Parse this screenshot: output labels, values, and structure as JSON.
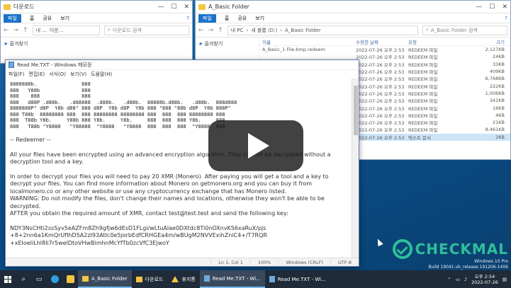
{
  "explorer_left": {
    "title": "다운로드",
    "menu": [
      "파일",
      "홈",
      "공유",
      "보기"
    ],
    "address": "내 ...",
    "address_item": "다운...",
    "search_placeholder": "다운로드 검색",
    "nav_quick": "즐겨찾기"
  },
  "explorer_right": {
    "title": "A_Basic Folder",
    "menu": [
      "파일",
      "홈",
      "공유",
      "보기"
    ],
    "path": [
      "내 PC",
      "새 볼륨 (D:)",
      "A_Basic Folder"
    ],
    "search_placeholder": "A_Basic Folder 검색",
    "nav_quick": "즐겨찾기",
    "columns": [
      "이름",
      "수정한 날짜",
      "유형",
      "크기"
    ],
    "files": [
      {
        "name": "A_Basic_1 File.bmp.redeem",
        "date": "2022-07-26 오후 2:53",
        "type": "REDEEM 파일",
        "size": "2,127KB"
      },
      {
        "name": "",
        "date": "2022-07-26 오후 2:53",
        "type": "REDEEM 파일",
        "size": "24KB"
      },
      {
        "name": "",
        "date": "2022-07-26 오후 2:53",
        "type": "REDEEM 파일",
        "size": "33KB"
      },
      {
        "name": "",
        "date": "2022-07-26 오후 2:53",
        "type": "REDEEM 파일",
        "size": "409KB"
      },
      {
        "name": "",
        "date": "2022-07-26 오후 2:53",
        "type": "REDEEM 파일",
        "size": "6,768KB"
      },
      {
        "name": "",
        "date": "2022-07-26 오후 2:53",
        "type": "REDEEM 파일",
        "size": "222KB"
      },
      {
        "name": "",
        "date": "2022-07-26 오후 2:53",
        "type": "REDEEM 파일",
        "size": "1,006KB"
      },
      {
        "name": "",
        "date": "2022-07-26 오후 2:53",
        "type": "REDEEM 파일",
        "size": "341KB"
      },
      {
        "name": "",
        "date": "2022-07-26 오후 2:53",
        "type": "REDEEM 파일",
        "size": "16KB"
      },
      {
        "name": "",
        "date": "2022-07-26 오후 2:53",
        "type": "REDEEM 파일",
        "size": "4KB"
      },
      {
        "name": "",
        "date": "2022-07-26 오후 2:53",
        "type": "REDEEM 파일",
        "size": "21KB"
      },
      {
        "name": "",
        "date": "2022-07-26 오후 2:53",
        "type": "REDEEM 파일",
        "size": "8,461KB"
      },
      {
        "name": "",
        "date": "2022-07-26 오후 2:53",
        "type": "텍스트 문서",
        "size": "2KB"
      }
    ]
  },
  "notepad": {
    "title": "Read Me.TXT - Windows 메모장",
    "menu": [
      "파일(F)",
      "편집(E)",
      "서식(O)",
      "보기(V)",
      "도움말(H)"
    ],
    "ascii_art": "8888888b.               888\n888   Y88b              888\n888    888              888\n888   d88P .d88b.   .d88888  .d88b.   .d88b.  88888b.d88b.   .d88b.  888d888\n8888888P\" d8P  Y8b d88\" 888 d8P  Y8b d8P  Y8b 888 \"888 \"88b d8P  Y8b 888P\"\n888 T88b  88888888 888  888 88888888 88888888 888  888  888 88888888 888\n888  T88b Y8b.     Y88b 888 Y8b.     Y8b.     888  888  888 Y8b.     888\n888   T88b \"Y8888   \"Y88888  \"Y8888   \"Y8888  888  888  888  \"Y8888  888",
    "heading": "-- Redeemer --",
    "paragraphs": [
      "All your files have been encrypted using an advanced encryption algorithm. They cannot be decrypted without a decryption tool and a key.",
      "In order to decrypt your files you will need to pay 20 XMR (Monero). After paying you will get a tool and a key to decrypt your files. You can find more information about Monero on getmonero.org and you can buy it from localmonero.co or any other website or use any cryptocurrency exchange that has Monero listed.",
      "WARNING: Do not modify the files, don't change their names and locations, otherwise they won't be able to be decrypted.",
      "AFTER you obtain the required amount of XMR, contact test@test.test and send the following key:"
    ],
    "key_lines": [
      "NDY3NsCHti2ssSyv5eAZFm8Zh9gfjw6dEsD1FLgi/wLtuAlae0DXtdc8Ti0nOXnvK56xaRuX/pjs",
      "+8+2nn6a1KmQrUfIhD5A2zI93AtIc0e5jorbEdfCRHGEa4m/wBUgM2NVVExihZniC4+/T7RQR",
      "+xEIoeIiLhl8Ii7r5welDtoVHwBimhnMcYfTb0zcVfC3EjwoY"
    ],
    "status": {
      "position": "Ln 1, Col 1",
      "zoom": "100%",
      "eol": "Windows (CRLF)",
      "encoding": "UTF-8"
    }
  },
  "watermark": {
    "text": "CHECKMAL"
  },
  "os_info": {
    "line1": "Windows 10 Pro",
    "line2": "Build 19041.vb_release.191206-1406"
  },
  "taskbar": {
    "items": [
      {
        "label": "A_Basic Folder",
        "icon": "folder-icon"
      },
      {
        "label": "다운로드",
        "icon": "folder-icon"
      },
      {
        "label": "휴지통",
        "icon": "warning-icon"
      },
      {
        "label": "Read Me.TXT - Wi...",
        "icon": "notepad-icon"
      },
      {
        "label": "Read Me.TXT - Wi...",
        "icon": "notepad-icon"
      }
    ],
    "clock_time": "오후 2:54",
    "clock_date": "2022-07-26"
  },
  "colors": {
    "accent": "#1a73c9",
    "watermark": "#2fbf9a",
    "taskbar": "#1f2b38"
  }
}
